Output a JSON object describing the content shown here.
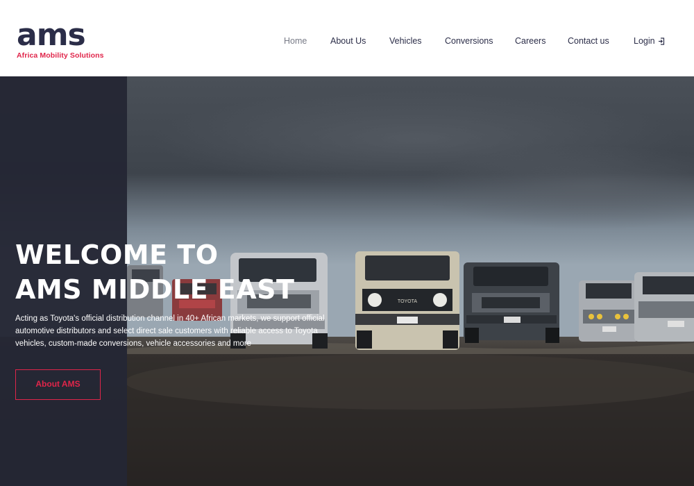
{
  "brand": {
    "logo_text": "ams",
    "tagline": "Africa Mobility Solutions",
    "primary_color": "#2b2d48",
    "accent_color": "#e0254a"
  },
  "nav": {
    "items": [
      {
        "label": "Home",
        "active": true
      },
      {
        "label": "About Us"
      },
      {
        "label": "Vehicles"
      },
      {
        "label": "Conversions"
      },
      {
        "label": "Careers"
      },
      {
        "label": "Contact us"
      }
    ],
    "login_label": "Login",
    "login_icon": "login-icon"
  },
  "hero": {
    "title_line1": "WELCOME TO",
    "title_line2": "AMS MIDDLE EAST",
    "description": "Acting as Toyota's official distribution channel in 40+ African markets, we support official automotive distributors and select direct sale customers with reliable access to Toyota vehicles, custom-made conversions, vehicle accessories and more",
    "cta_label": "About AMS",
    "vehicle_grille_text": "TOYOTA"
  }
}
